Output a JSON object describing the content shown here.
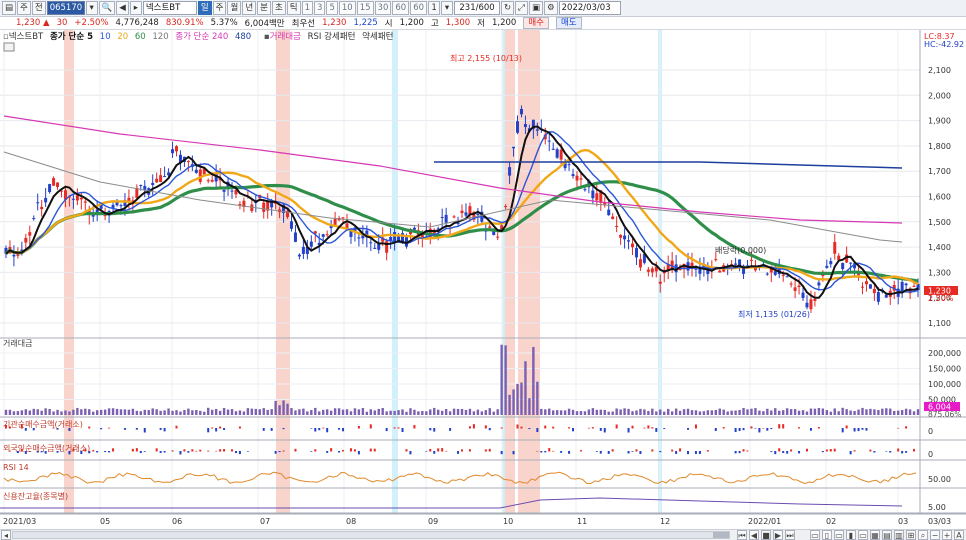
{
  "toolbar": {
    "b1": "주",
    "b2": "전",
    "code": "065170",
    "stock_name": "넥스트BT",
    "chart_type_button": "일",
    "periods": [
      "주",
      "월",
      "년",
      "분",
      "초",
      "틱"
    ],
    "minute_values": [
      "1",
      "3",
      "5",
      "10",
      "15",
      "30",
      "60",
      "60"
    ],
    "unit_value": "1",
    "count": "231/600",
    "date": "2022/03/03"
  },
  "quote": {
    "price": "1,230",
    "arrow": "▲",
    "change": "30",
    "change_pct": "+2.50%",
    "volume": "4,776,248",
    "vol_ratio": "830.91%",
    "turnover": "5.37%",
    "amount": "6,004백만",
    "highlight_label": "최우선",
    "ask": "1,230",
    "bid": "1,225",
    "open_label": "시",
    "open": "1,200",
    "high_label": "고",
    "high": "1,300",
    "low_label": "저",
    "low": "1,200",
    "buy_button": "매수",
    "sell_button": "매도"
  },
  "legend": {
    "main_name": "넥스트BT",
    "ma_label": "종가 단순 5",
    "ma10": "10",
    "ma20": "20",
    "ma60": "60",
    "ma120": "120",
    "ma2_label": "종가 단순 240",
    "ma480": "480",
    "vol_label": "거래대금",
    "rsi_pattern": "RSI 강세패턴",
    "weak_pattern": "약세패턴"
  },
  "annotations": {
    "high": "최고 2,155 (10/13)",
    "low": "최저 1,135 (01/26)",
    "dividend": "배당락(0.000)"
  },
  "right_info": {
    "lc": "LC:8.37",
    "hc": "HC:-42.92",
    "price_tag": "1,230",
    "pct_tag": "2.50%",
    "vol_tag": "6,004",
    "vol_pct": "875.06%"
  },
  "price_axis": [
    "2,100",
    "2,000",
    "1,900",
    "1,800",
    "1,700",
    "1,600",
    "1,500",
    "1,400",
    "1,300",
    "1,200",
    "1,100"
  ],
  "volume_axis": [
    "200,000",
    "150,000",
    "100,000",
    "50,000"
  ],
  "panels": {
    "volume": "거래대금",
    "inst": "기관순매수금액(거래소)",
    "foreign": "외국인순매수금액(거래소)",
    "rsi": "RSI 14",
    "credit": "신용잔고율(종목별)"
  },
  "sub_axis": {
    "inst": "0",
    "foreign": "0",
    "rsi": "50.00",
    "credit": "5.00"
  },
  "date_axis": [
    "2021/03",
    "05",
    "06",
    "07",
    "08",
    "09",
    "10",
    "11",
    "12",
    "2022/01",
    "02",
    "03",
    "03/03"
  ],
  "colors": {
    "up": "#e52b24",
    "down": "#2341c9",
    "ma5": "#111111",
    "ma10": "#2a55d6",
    "ma20": "#f0a818",
    "ma60": "#2f8f4a",
    "ma120": "#8b8b8b",
    "ma240": "#d637b4",
    "ma480": "#1d3e9e",
    "band": "#f7c9c0",
    "band2": "#cdeffa"
  }
}
